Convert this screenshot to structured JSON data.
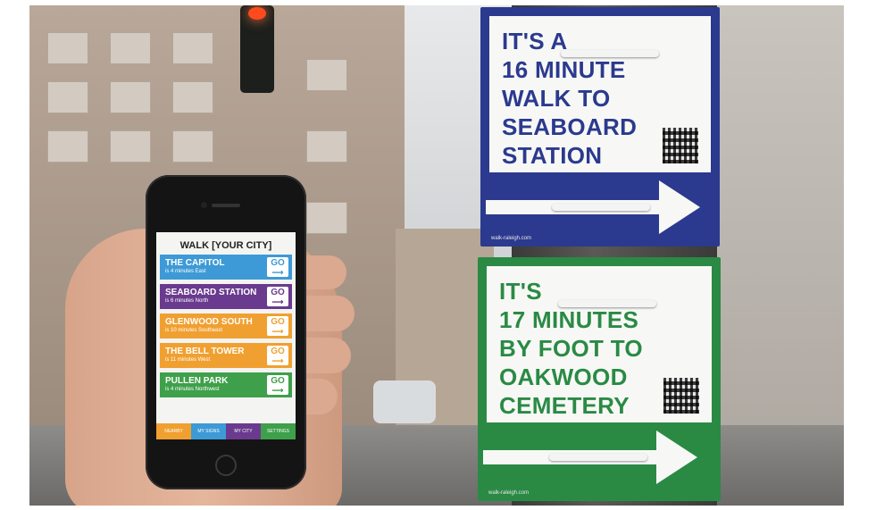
{
  "colors": {
    "blue_sign": "#2b3a8e",
    "green_sign": "#2a8a44"
  },
  "phone_app": {
    "title": "WALK [YOUR CITY]",
    "destinations": [
      {
        "name": "THE CAPITOL",
        "detail": "is 4 minutes East",
        "go": "GO",
        "color": "#3d9ad6"
      },
      {
        "name": "SEABOARD STATION",
        "detail": "is 6 minutes North",
        "go": "GO",
        "color": "#6a3a8e"
      },
      {
        "name": "GLENWOOD SOUTH",
        "detail": "is 10 minutes Southeast",
        "go": "GO",
        "color": "#f0a030"
      },
      {
        "name": "THE BELL TOWER",
        "detail": "is 11 minutes West",
        "go": "GO",
        "color": "#f0a030"
      },
      {
        "name": "PULLEN PARK",
        "detail": "is 4 minutes Northwest",
        "go": "GO",
        "color": "#3ea04a"
      }
    ],
    "tabs": [
      {
        "label": "NEARBY",
        "color": "#f0a030"
      },
      {
        "label": "MY SIGNS",
        "color": "#3d9ad6"
      },
      {
        "label": "MY CITY",
        "color": "#6a3a8e"
      },
      {
        "label": "SETTINGS",
        "color": "#3ea04a"
      }
    ]
  },
  "signs": {
    "blue": {
      "text": "IT'S A\n16 MINUTE\nWALK TO\nSEABOARD\nSTATION",
      "url": "walk-raleigh.com"
    },
    "green": {
      "text": "IT'S\n17 MINUTES\nBY FOOT TO\nOAKWOOD\nCEMETERY",
      "url": "walk-raleigh.com"
    }
  },
  "icons": [
    "qr-code-icon",
    "right-arrow-icon",
    "go-arrow-icon",
    "traffic-light-icon"
  ]
}
